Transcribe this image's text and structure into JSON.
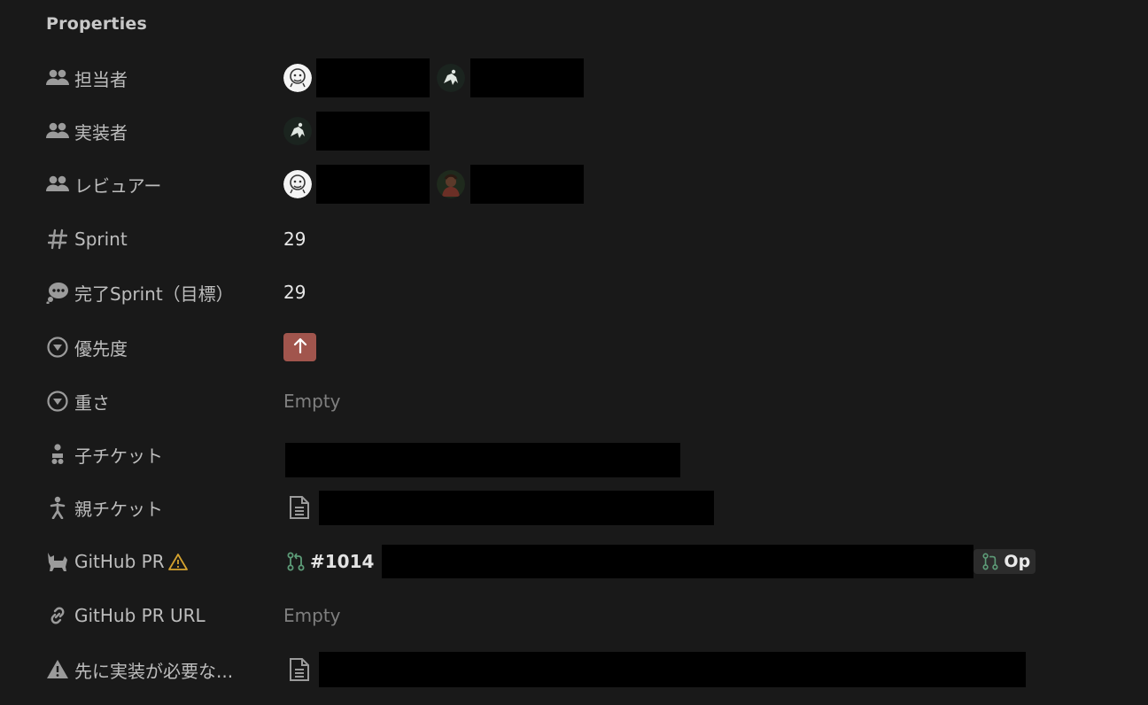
{
  "section": {
    "title": "Properties"
  },
  "properties": [
    {
      "label": "担当者",
      "icon": "people-icon"
    },
    {
      "label": "実装者",
      "icon": "people-icon"
    },
    {
      "label": "レビュアー",
      "icon": "people-icon"
    },
    {
      "label": "Sprint",
      "icon": "hash-icon",
      "value": "29"
    },
    {
      "label": "完了Sprint（目標）",
      "icon": "thought-bubble-icon",
      "value": "29"
    },
    {
      "label": "優先度",
      "icon": "select-circle-icon",
      "value_icon": "arrow-up-icon",
      "tag_color": "#a1554d"
    },
    {
      "label": "重さ",
      "icon": "select-circle-icon",
      "value": "Empty"
    },
    {
      "label": "子チケット",
      "icon": "child-person-icon"
    },
    {
      "label": "親チケット",
      "icon": "person-icon",
      "value_icon": "document-icon"
    },
    {
      "label": "GitHub PR",
      "icon": "cat-icon",
      "warning_icon": "warning-triangle-icon",
      "pr_number": "#1014",
      "pr_status": "Op"
    },
    {
      "label": "GitHub PR URL",
      "icon": "link-icon",
      "value": "Empty"
    },
    {
      "label": "先に実装が必要な...",
      "icon": "warning-filled-icon",
      "value_icon": "document-icon"
    }
  ]
}
